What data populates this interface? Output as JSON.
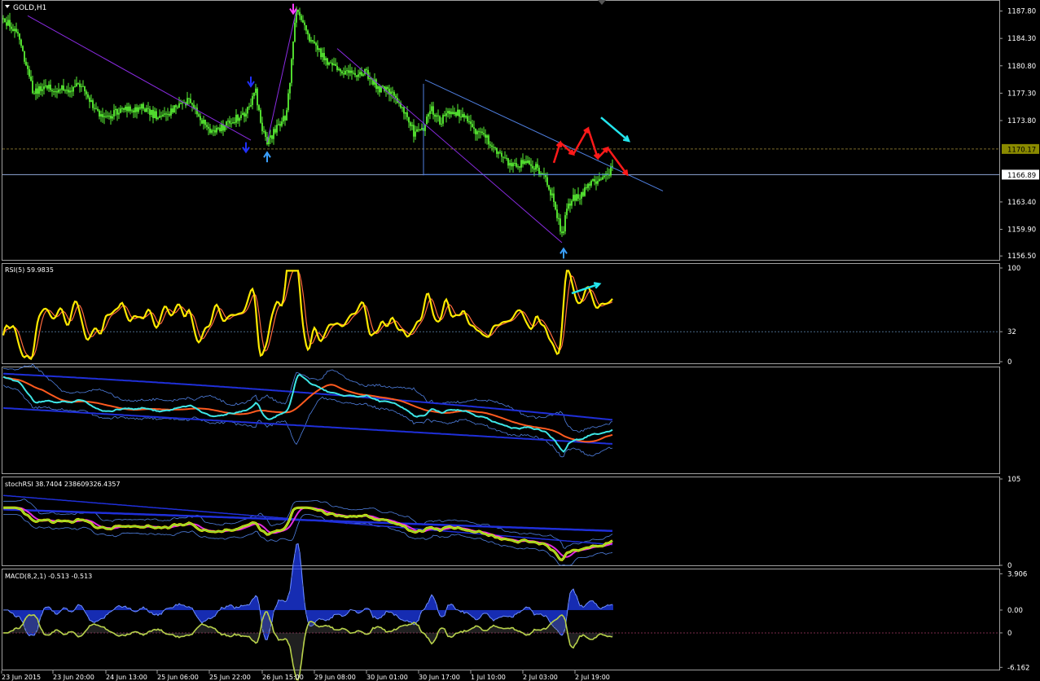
{
  "chart_data": {
    "type": "candlestick",
    "symbol_title": "GOLD,H1",
    "x_tick_labels": [
      "23 Jun 2015",
      "23 Jun 20:00",
      "24 Jun 13:00",
      "25 Jun 06:00",
      "25 Jun 22:00",
      "26 Jun 15:00",
      "29 Jun 08:00",
      "30 Jun 01:00",
      "30 Jun 17:00",
      "1 Jul 10:00",
      "2 Jul 03:00",
      "2 Jul 19:00"
    ],
    "price": {
      "y_ticks": [
        1187.8,
        1184.3,
        1180.8,
        1177.3,
        1173.8,
        1170.17,
        1166.89,
        1163.4,
        1159.9,
        1156.5
      ],
      "y_tick_labels": [
        "1187.80",
        "1184.30",
        "1180.80",
        "1177.30",
        "1173.80",
        "1170.17",
        "1166.89",
        "1163.40",
        "1159.90",
        "1156.50"
      ],
      "ylim": [
        1156.0,
        1189.0
      ],
      "tagged_levels": [
        {
          "label": "1170.17",
          "value": 1170.17,
          "color": "#8a8a00"
        },
        {
          "label": "1166.89",
          "value": 1166.89,
          "color": "#ffffff"
        }
      ],
      "anchors": [
        [
          0,
          1187.0
        ],
        [
          10,
          1184.3
        ],
        [
          18,
          1177.5
        ],
        [
          28,
          1178.0
        ],
        [
          40,
          1177.8
        ],
        [
          48,
          1178.5
        ],
        [
          56,
          1175.0
        ],
        [
          65,
          1174.4
        ],
        [
          72,
          1175.3
        ],
        [
          85,
          1175.4
        ],
        [
          92,
          1174.5
        ],
        [
          100,
          1174.2
        ],
        [
          108,
          1175.9
        ],
        [
          115,
          1176.5
        ],
        [
          120,
          1174.0
        ],
        [
          128,
          1172.5
        ],
        [
          134,
          1172.8
        ],
        [
          140,
          1173.8
        ],
        [
          146,
          1174.2
        ],
        [
          152,
          1176.0
        ],
        [
          155,
          1177.8
        ],
        [
          158,
          1173.2
        ],
        [
          162,
          1171.0
        ],
        [
          166,
          1172.2
        ],
        [
          170,
          1173.6
        ],
        [
          174,
          1174.6
        ],
        [
          180,
          1188.0
        ],
        [
          186,
          1185.0
        ],
        [
          192,
          1183.0
        ],
        [
          198,
          1181.5
        ],
        [
          206,
          1180.2
        ],
        [
          214,
          1179.6
        ],
        [
          222,
          1180.2
        ],
        [
          230,
          1178.0
        ],
        [
          238,
          1177.5
        ],
        [
          246,
          1175.2
        ],
        [
          252,
          1172.2
        ],
        [
          258,
          1172.5
        ],
        [
          262,
          1175.5
        ],
        [
          268,
          1173.8
        ],
        [
          276,
          1175.0
        ],
        [
          284,
          1174.5
        ],
        [
          290,
          1172.5
        ],
        [
          296,
          1171.8
        ],
        [
          302,
          1170.0
        ],
        [
          310,
          1168.5
        ],
        [
          318,
          1168.3
        ],
        [
          326,
          1168.0
        ],
        [
          334,
          1166.0
        ],
        [
          338,
          1163.5
        ],
        [
          343,
          1159.0
        ],
        [
          346,
          1162.5
        ],
        [
          350,
          1163.8
        ],
        [
          356,
          1164.6
        ],
        [
          362,
          1165.8
        ],
        [
          368,
          1166.6
        ],
        [
          374,
          1167.5
        ]
      ],
      "sr_text": "GOLD H1 candlestick chart"
    },
    "rsi": {
      "title": "RSI(5) 59.9835",
      "y_ticks": [
        100,
        32,
        0
      ],
      "ylim": [
        0,
        100
      ],
      "level": 32
    },
    "bands": {
      "title": ""
    },
    "stochrsi": {
      "title": "stochRSI 38.7404 238609326.4357",
      "y_ticks": [
        105,
        0
      ],
      "y_tick_labels": [
        "105",
        "0"
      ],
      "ylim": [
        0,
        105
      ]
    },
    "macd": {
      "title": "MACD(8,2,1) -0.513 -0.513",
      "y_ticks": [
        3.906,
        0.0,
        0,
        -6.162
      ],
      "y_tick_labels": [
        "3.906",
        "0.00",
        "0",
        "-6.162"
      ],
      "ylim": [
        -6.4,
        4.2
      ]
    }
  },
  "colors": {
    "background": "#000000",
    "candle": "#59ef33",
    "grid_border": "#a0a0a0",
    "trend_blue": "#4f7fe0",
    "trend_purple": "#8a2be2",
    "rsi_main": "#ffea00",
    "rsi_signal": "#ff6a3d",
    "cyan": "#3ee6e6",
    "orange": "#ff5a1f",
    "navy_band": "#1f2fd9",
    "magenta": "#e02de0",
    "macd_hist": "#1f3fff",
    "macd_line": "#b8d24a",
    "arrow_red": "#ff1a1a",
    "arrow_cyan": "#23e6ee"
  }
}
